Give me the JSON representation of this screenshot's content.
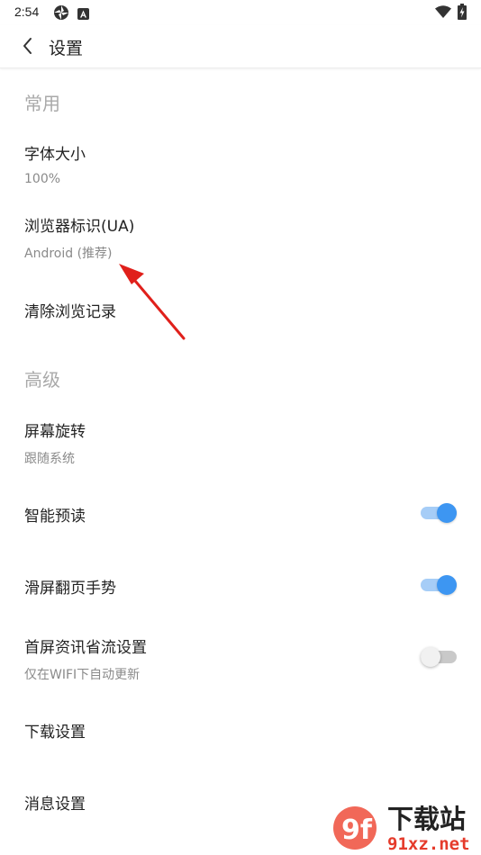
{
  "status_bar": {
    "time": "2:54",
    "icons": [
      "pinwheel-icon",
      "a-badge-icon",
      "wifi-icon",
      "battery-charging-icon"
    ]
  },
  "app_bar": {
    "back_icon": "chevron-left-icon",
    "title": "设置"
  },
  "sections": {
    "common": {
      "header": "常用",
      "font_size": {
        "title": "字体大小",
        "value": "100%"
      },
      "user_agent": {
        "title": "浏览器标识(UA)",
        "value": "Android (推荐)"
      },
      "clear_history": {
        "title": "清除浏览记录"
      }
    },
    "advanced": {
      "header": "高级",
      "screen_rotation": {
        "title": "屏幕旋转",
        "value": "跟随系统"
      },
      "smart_preload": {
        "title": "智能预读",
        "enabled": true
      },
      "swipe_page_gesture": {
        "title": "滑屏翻页手势",
        "enabled": true
      },
      "homepage_data_saver": {
        "title": "首屏资讯省流设置",
        "subtitle": "仅在WIFI下自动更新",
        "enabled": false
      },
      "download_settings": {
        "title": "下载设置"
      },
      "message_settings": {
        "title": "消息设置"
      }
    }
  },
  "colors": {
    "toggle_on_thumb": "#3d96f2",
    "toggle_on_track": "#a6cdf7",
    "toggle_off_track": "#c9c9c9",
    "annotation_arrow": "#e0201b",
    "section_header": "#a9a9a9"
  },
  "watermark": {
    "logo_text": "9f",
    "text": "下载站",
    "domain": "91xz.net"
  }
}
